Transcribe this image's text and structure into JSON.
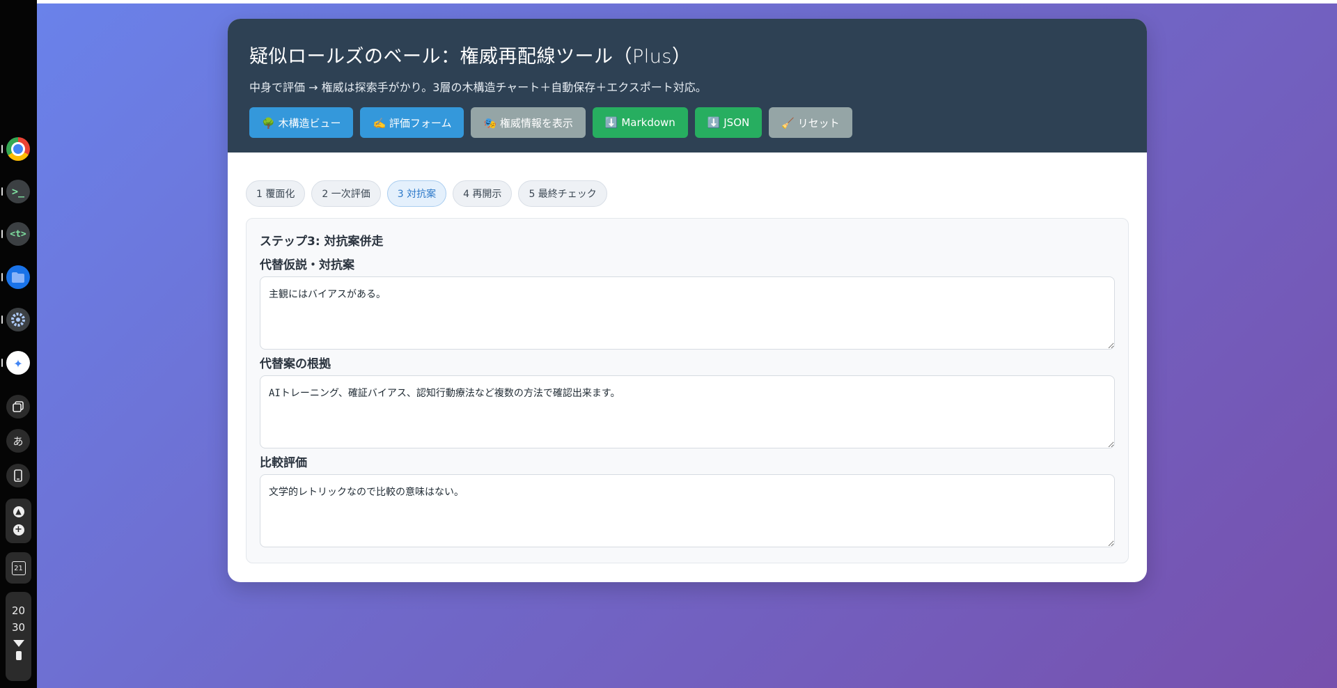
{
  "shelf": {
    "apps": [
      {
        "name": "chrome-icon",
        "running": true
      },
      {
        "name": "terminal-icon",
        "label": ">_",
        "running": true
      },
      {
        "name": "text-editor-icon",
        "label": "<t>",
        "running": true
      },
      {
        "name": "files-icon",
        "running": true
      },
      {
        "name": "settings-icon",
        "running": true
      },
      {
        "name": "assistant-icon",
        "running": true
      }
    ],
    "ime_label": "あ",
    "calendar_day": "21",
    "clock": {
      "hour": "20",
      "minute": "30"
    }
  },
  "app": {
    "title": "疑似ロールズのベール：権威再配線ツール（Plus）",
    "subtitle": "中身で評価 → 権威は探索手がかり。3層の木構造チャート＋自動保存＋エクスポート対応。",
    "toolbar": {
      "tree_view": "🌳 木構造ビュー",
      "eval_form": "✍️ 評価フォーム",
      "show_authority": "🎭 権威情報を表示",
      "export_markdown": "⬇️ Markdown",
      "export_json": "⬇️ JSON",
      "reset": "🧹 リセット"
    },
    "tabs": [
      {
        "label": "1 覆面化"
      },
      {
        "label": "2 一次評価"
      },
      {
        "label": "3 対抗案",
        "active": true
      },
      {
        "label": "4 再開示"
      },
      {
        "label": "5 最終チェック"
      }
    ],
    "step": {
      "title": "ステップ3: 対抗案併走",
      "fields": [
        {
          "label": "代替仮説・対抗案",
          "value": "主観にはバイアスがある。"
        },
        {
          "label": "代替案の根拠",
          "value": "AIトレーニング、確証バイアス、認知行動療法など複数の方法で確認出来ます。"
        },
        {
          "label": "比較評価",
          "value": "文学的レトリックなので比較の意味はない。"
        }
      ]
    }
  },
  "colors": {
    "header_bg": "#2e4154",
    "primary": "#3498db",
    "secondary": "#95a5a6",
    "success": "#27ae60",
    "active_tab": "#2c78c8"
  }
}
